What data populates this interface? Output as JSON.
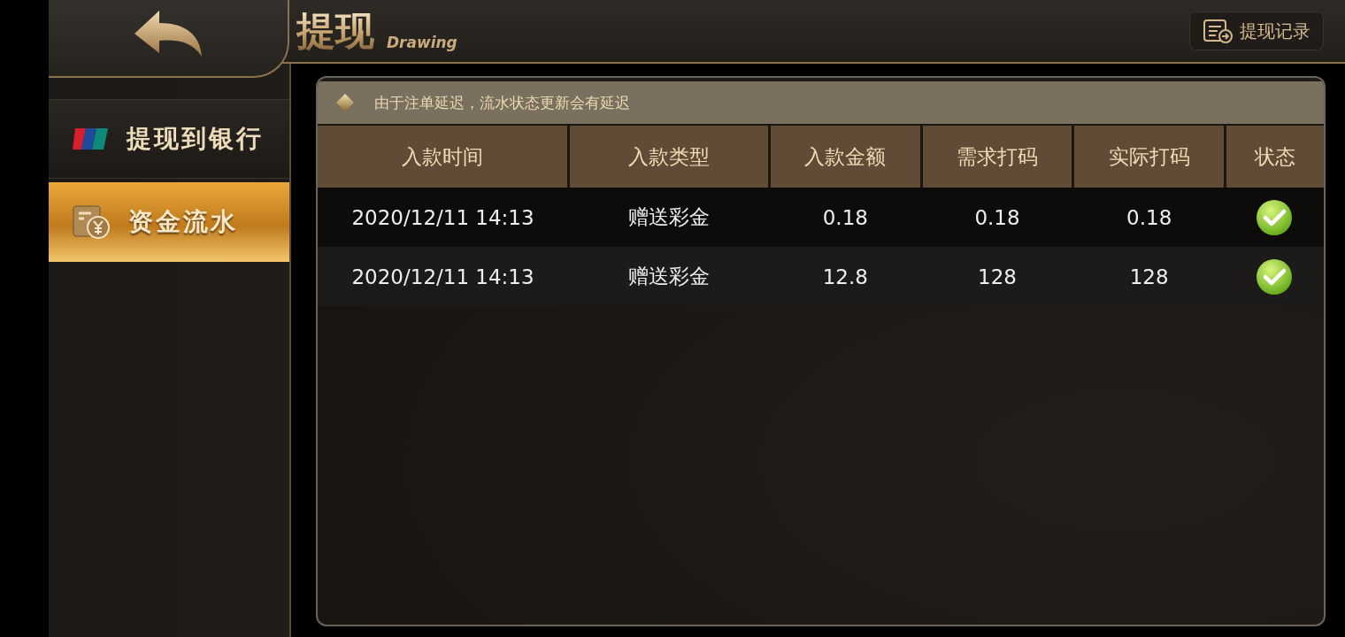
{
  "header": {
    "title": "提现",
    "subtitle": "Drawing",
    "record_button": "提现记录"
  },
  "sidebar": {
    "items": [
      {
        "label": "提现到银行",
        "kind": "bank",
        "selected": false
      },
      {
        "label": "资金流水",
        "kind": "ledger",
        "selected": true
      }
    ]
  },
  "notice": "由于注单延迟，流水状态更新会有延迟",
  "table": {
    "columns": [
      "入款时间",
      "入款类型",
      "入款金额",
      "需求打码",
      "实际打码",
      "状态"
    ],
    "rows": [
      {
        "cells": [
          "2020/12/11 14:13",
          "赠送彩金",
          "0.18",
          "0.18",
          "0.18"
        ],
        "completed": true
      },
      {
        "cells": [
          "2020/12/11 14:13",
          "赠送彩金",
          "12.8",
          "128",
          "128"
        ],
        "completed": true
      }
    ]
  }
}
